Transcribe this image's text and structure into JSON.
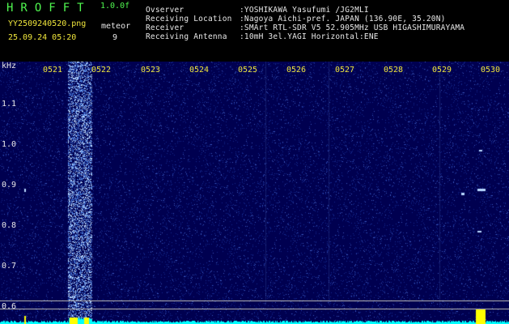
{
  "header": {
    "logo": "HROFFT",
    "version": "1.0.0f",
    "filename": "YY2509240520.png",
    "datetime": "25.09.24 05:20",
    "meteor_label": "meteor",
    "meteor_count": "9",
    "info_labels": [
      "Ovserver",
      "Receiving Location",
      "Receiver",
      "Receiving Antenna"
    ],
    "info_values": [
      ":YOSHIKAWA Yasufumi /JG2MLI",
      ":Nagoya Aichi-pref. JAPAN (136.90E, 35.20N)",
      ":SMArt RTL-SDR V5 52.905MHz USB HIGASHIMURAYAMA",
      ":10mH 3el.YAGI Horizontal:ENE"
    ]
  },
  "spectrogram": {
    "unit": "kHz",
    "time_ticks": [
      "0521",
      "0522",
      "0523",
      "0524",
      "0525",
      "0526",
      "0527",
      "0528",
      "0529",
      "0530"
    ],
    "freq_ticks": [
      "1.1",
      "1.0",
      "0.9",
      "0.8",
      "0.7",
      "0.6"
    ],
    "colors": {
      "background": "#000050",
      "text_green": "#4ff64f",
      "text_yellow": "#f0e63c",
      "signal": "#e0f0ff",
      "baseline": "#00ffff",
      "burst": "#ffff00"
    }
  }
}
